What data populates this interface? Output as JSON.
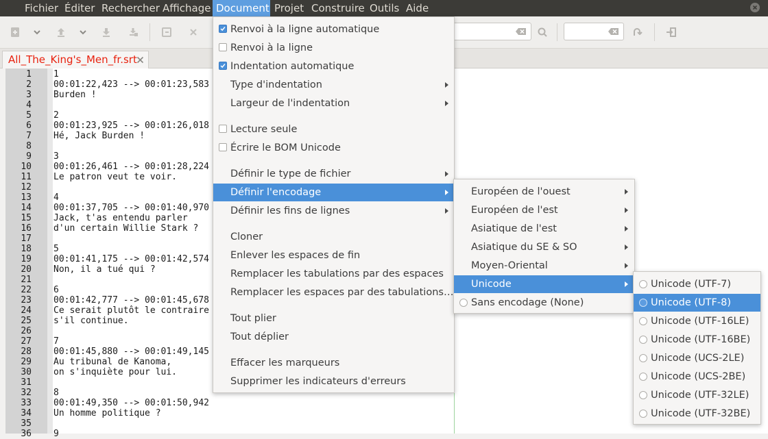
{
  "menubar": {
    "items": [
      "Fichier",
      "Éditer",
      "Rechercher",
      "Affichage",
      "Document",
      "Projet",
      "Construire",
      "Outils",
      "Aide"
    ],
    "active": "Document"
  },
  "tab": {
    "filename": "All_The_King's_Men_fr.srt"
  },
  "editor": {
    "lines": [
      "1",
      "00:01:22,423 --> 00:01:23,583",
      "Burden !",
      "",
      "2",
      "00:01:23,925 --> 00:01:26,018",
      "Hé, Jack Burden !",
      "",
      "3",
      "00:01:26,461 --> 00:01:28,224",
      "Le patron veut te voir.",
      "",
      "4",
      "00:01:37,705 --> 00:01:40,970",
      "Jack, t'as entendu parler",
      "d'un certain Willie Stark ?",
      "",
      "5",
      "00:01:41,175 --> 00:01:42,574",
      "Non, il a tué qui ?",
      "",
      "6",
      "00:01:42,777 --> 00:01:45,678",
      "Ce serait plutôt le contraire",
      "s'il continue.",
      "",
      "7",
      "00:01:45,880 --> 00:01:49,145",
      "Au tribunal de Kanoma,",
      "on s'inquiète pour lui.",
      "",
      "8",
      "00:01:49,350 --> 00:01:50,942",
      "Un homme politique ?",
      "",
      "9"
    ]
  },
  "document_menu": {
    "items": [
      {
        "label": "Renvoi à la ligne automatique",
        "check": true
      },
      {
        "label": "Renvoi à la ligne",
        "check": false
      },
      {
        "label": "Indentation automatique",
        "check": true
      },
      {
        "label": "Type d'indentation",
        "submenu": true
      },
      {
        "label": "Largeur de l'indentation",
        "submenu": true
      },
      {
        "label": "Lecture seule",
        "check": false
      },
      {
        "label": "Écrire le BOM Unicode",
        "check": false
      },
      {
        "label": "Définir le type de fichier",
        "submenu": true
      },
      {
        "label": "Définir l'encodage",
        "submenu": true,
        "highlighted": true
      },
      {
        "label": "Définir les fins de lignes",
        "submenu": true
      },
      {
        "label": "Cloner"
      },
      {
        "label": "Enlever les espaces de fin"
      },
      {
        "label": "Remplacer les tabulations par des espaces"
      },
      {
        "label": "Remplacer les espaces par des tabulations…"
      },
      {
        "label": "Tout plier"
      },
      {
        "label": "Tout déplier"
      },
      {
        "label": "Effacer les marqueurs"
      },
      {
        "label": "Supprimer les indicateurs d'erreurs"
      }
    ]
  },
  "encoding_menu": {
    "items": [
      {
        "label": "Européen de l'ouest",
        "submenu": true
      },
      {
        "label": "Européen de l'est",
        "submenu": true
      },
      {
        "label": "Asiatique de l'est",
        "submenu": true
      },
      {
        "label": "Asiatique du SE & SO",
        "submenu": true
      },
      {
        "label": "Moyen-Oriental",
        "submenu": true
      },
      {
        "label": "Unicode",
        "submenu": true,
        "highlighted": true
      },
      {
        "label": "Sans encodage (None)",
        "radio": true
      }
    ]
  },
  "unicode_menu": {
    "items": [
      {
        "label": "Unicode (UTF-7)"
      },
      {
        "label": "Unicode (UTF-8)",
        "highlighted": true
      },
      {
        "label": "Unicode (UTF-16LE)"
      },
      {
        "label": "Unicode (UTF-16BE)"
      },
      {
        "label": "Unicode (UCS-2LE)"
      },
      {
        "label": "Unicode (UCS-2BE)"
      },
      {
        "label": "Unicode (UTF-32LE)"
      },
      {
        "label": "Unicode (UTF-32BE)"
      }
    ]
  },
  "colors": {
    "menubar_bg": "#3c3b37",
    "highlight": "#4a90d9",
    "tab_text": "#e8220f"
  }
}
